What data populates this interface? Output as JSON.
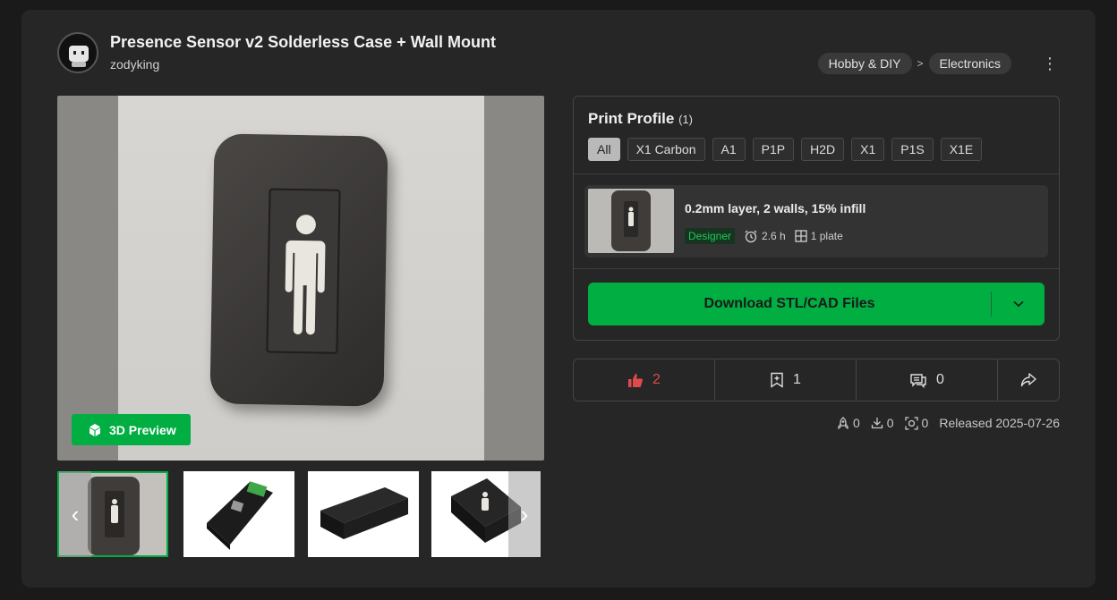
{
  "header": {
    "title": "Presence Sensor v2 Solderless Case + Wall Mount",
    "author": "zodyking",
    "breadcrumbs": [
      "Hobby & DIY",
      "Electronics"
    ],
    "breadcrumb_separator": ">"
  },
  "gallery": {
    "preview_label": "3D Preview",
    "thumbnail_count": 4
  },
  "profile": {
    "title": "Print Profile",
    "count": "(1)",
    "printers": [
      "All",
      "X1 Carbon",
      "A1",
      "P1P",
      "H2D",
      "X1",
      "P1S",
      "X1E"
    ],
    "selected_printer": "All",
    "plate": {
      "name": "0.2mm layer, 2 walls, 15% infill",
      "badge": "Designer",
      "time": "2.6 h",
      "plates": "1 plate"
    },
    "download_label": "Download STL/CAD Files"
  },
  "actions": {
    "likes": "2",
    "collects": "1",
    "comments": "0"
  },
  "stats": {
    "boosts": "0",
    "downloads": "0",
    "prints": "0",
    "released": "Released 2025-07-26"
  },
  "colors": {
    "accent": "#00ae42",
    "like": "#e14a4a",
    "background": "#262626"
  }
}
